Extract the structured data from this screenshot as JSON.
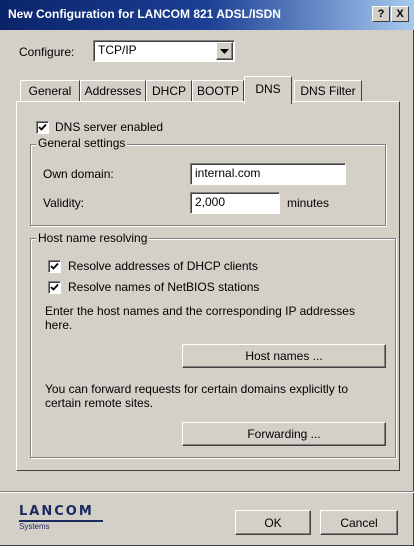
{
  "window": {
    "title": "New Configuration for LANCOM 821 ADSL/ISDN"
  },
  "titlebar": {
    "help_label": "?",
    "close_label": "X"
  },
  "configure": {
    "label": "Configure:",
    "selected": "TCP/IP"
  },
  "tabs": [
    {
      "label": "General"
    },
    {
      "label": "Addresses"
    },
    {
      "label": "DHCP"
    },
    {
      "label": "BOOTP"
    },
    {
      "label": "DNS"
    },
    {
      "label": "DNS Filter"
    }
  ],
  "dns": {
    "server_enabled_label": "DNS server enabled",
    "server_enabled": true,
    "general_settings": {
      "legend": "General settings",
      "own_domain_label": "Own domain:",
      "own_domain_value": "internal.com",
      "validity_label": "Validity:",
      "validity_value": "2,000",
      "validity_unit": "minutes"
    },
    "host_resolving": {
      "legend": "Host name resolving",
      "resolve_dhcp_label": "Resolve addresses of DHCP clients",
      "resolve_dhcp": true,
      "resolve_netbios_label": "Resolve names of NetBIOS stations",
      "resolve_netbios": true,
      "hostnames_hint": "Enter the host names and the corresponding IP addresses here.",
      "hostnames_button": "Host names ...",
      "forward_hint": "You can forward requests for certain domains explicitly to certain remote sites.",
      "forwarding_button": "Forwarding ..."
    }
  },
  "footer": {
    "logo_text": "LANCOM",
    "logo_subtext": "Systems",
    "ok_label": "OK",
    "cancel_label": "Cancel"
  }
}
